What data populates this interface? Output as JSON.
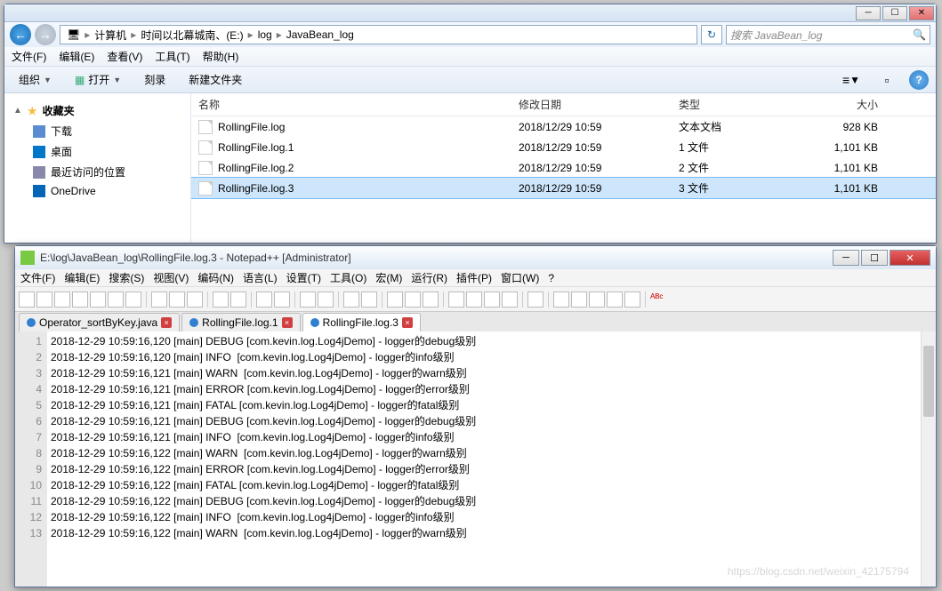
{
  "explorer": {
    "breadcrumb": [
      "计算机",
      "时间以北幕城南、(E:)",
      "log",
      "JavaBean_log"
    ],
    "search_placeholder": "搜索 JavaBean_log",
    "menus": [
      "文件(F)",
      "编辑(E)",
      "查看(V)",
      "工具(T)",
      "帮助(H)"
    ],
    "toolbar": {
      "org": "组织",
      "open": "打开",
      "burn": "刻录",
      "newfolder": "新建文件夹"
    },
    "sidebar": {
      "fav": "收藏夹",
      "items": [
        {
          "label": "下载"
        },
        {
          "label": "桌面"
        },
        {
          "label": "最近访问的位置"
        },
        {
          "label": "OneDrive"
        }
      ]
    },
    "columns": {
      "name": "名称",
      "date": "修改日期",
      "type": "类型",
      "size": "大小"
    },
    "files": [
      {
        "name": "RollingFile.log",
        "date": "2018/12/29 10:59",
        "type": "文本文档",
        "size": "928 KB"
      },
      {
        "name": "RollingFile.log.1",
        "date": "2018/12/29 10:59",
        "type": "1 文件",
        "size": "1,101 KB"
      },
      {
        "name": "RollingFile.log.2",
        "date": "2018/12/29 10:59",
        "type": "2 文件",
        "size": "1,101 KB"
      },
      {
        "name": "RollingFile.log.3",
        "date": "2018/12/29 10:59",
        "type": "3 文件",
        "size": "1,101 KB"
      }
    ]
  },
  "npp": {
    "title": "E:\\log\\JavaBean_log\\RollingFile.log.3 - Notepad++ [Administrator]",
    "menus": [
      "文件(F)",
      "编辑(E)",
      "搜索(S)",
      "视图(V)",
      "编码(N)",
      "语言(L)",
      "设置(T)",
      "工具(O)",
      "宏(M)",
      "运行(R)",
      "插件(P)",
      "窗口(W)",
      "?"
    ],
    "tabs": [
      {
        "label": "Operator_sortByKey.java"
      },
      {
        "label": "RollingFile.log.1"
      },
      {
        "label": "RollingFile.log.3"
      }
    ],
    "lines": [
      "2018-12-29 10:59:16,120 [main] DEBUG [com.kevin.log.Log4jDemo] - logger的debug级别",
      "2018-12-29 10:59:16,120 [main] INFO  [com.kevin.log.Log4jDemo] - logger的info级别",
      "2018-12-29 10:59:16,121 [main] WARN  [com.kevin.log.Log4jDemo] - logger的warn级别",
      "2018-12-29 10:59:16,121 [main] ERROR [com.kevin.log.Log4jDemo] - logger的error级别",
      "2018-12-29 10:59:16,121 [main] FATAL [com.kevin.log.Log4jDemo] - logger的fatal级别",
      "2018-12-29 10:59:16,121 [main] DEBUG [com.kevin.log.Log4jDemo] - logger的debug级别",
      "2018-12-29 10:59:16,121 [main] INFO  [com.kevin.log.Log4jDemo] - logger的info级别",
      "2018-12-29 10:59:16,122 [main] WARN  [com.kevin.log.Log4jDemo] - logger的warn级别",
      "2018-12-29 10:59:16,122 [main] ERROR [com.kevin.log.Log4jDemo] - logger的error级别",
      "2018-12-29 10:59:16,122 [main] FATAL [com.kevin.log.Log4jDemo] - logger的fatal级别",
      "2018-12-29 10:59:16,122 [main] DEBUG [com.kevin.log.Log4jDemo] - logger的debug级别",
      "2018-12-29 10:59:16,122 [main] INFO  [com.kevin.log.Log4jDemo] - logger的info级别",
      "2018-12-29 10:59:16,122 [main] WARN  [com.kevin.log.Log4jDemo] - logger的warn级别"
    ],
    "watermark": "https://blog.csdn.net/weixin_42175794"
  }
}
